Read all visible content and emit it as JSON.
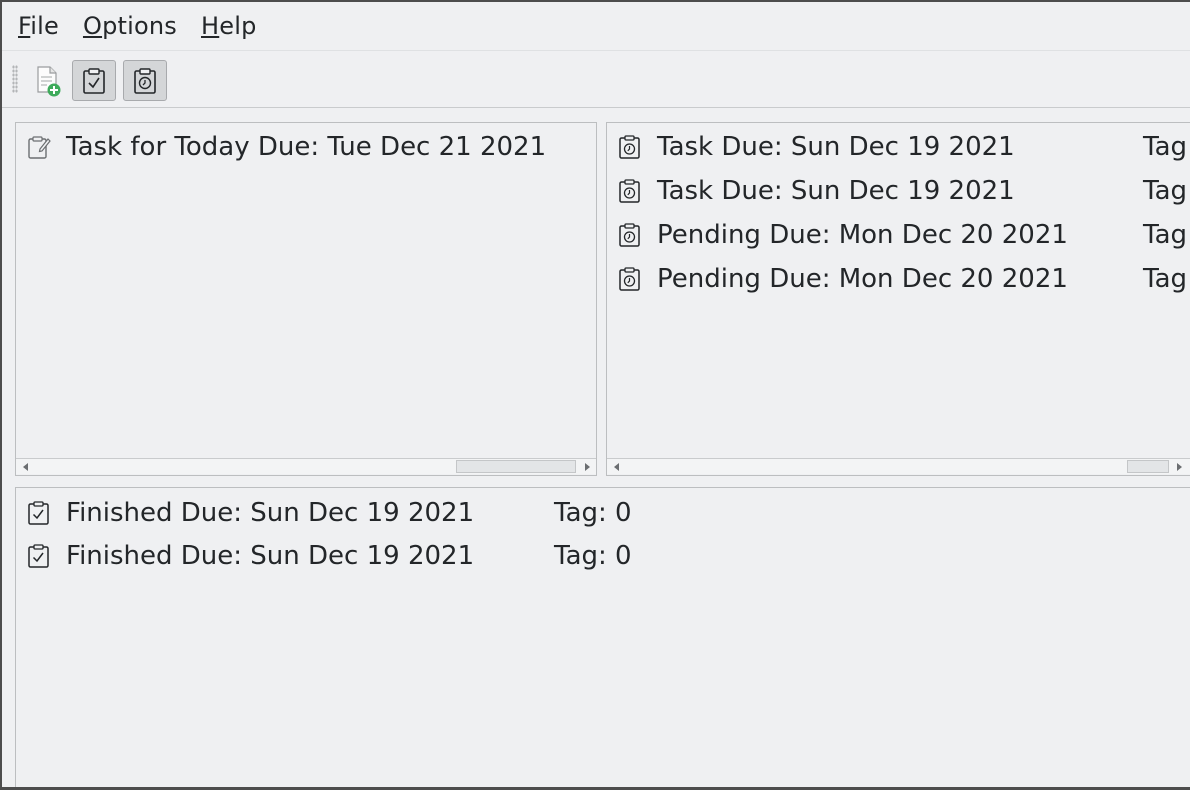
{
  "menubar": {
    "items": [
      {
        "mnemonic": "F",
        "rest": "ile"
      },
      {
        "mnemonic": "O",
        "rest": "ptions"
      },
      {
        "mnemonic": "H",
        "rest": "elp"
      }
    ]
  },
  "toolbar": {
    "buttons": [
      {
        "icon": "new-task-icon",
        "checked": false
      },
      {
        "icon": "clipboard-check-icon",
        "checked": true
      },
      {
        "icon": "clipboard-clock-icon",
        "checked": true
      }
    ]
  },
  "today_list": {
    "items": [
      {
        "icon": "clipboard-edit-icon",
        "text": "Task for Today  Due: Tue Dec 21 2021"
      }
    ]
  },
  "pending_list": {
    "items": [
      {
        "icon": "clipboard-clock-icon",
        "text": "Task  Due: Sun Dec 19 2021",
        "tag": "Tag"
      },
      {
        "icon": "clipboard-clock-icon",
        "text": "Task  Due: Sun Dec 19 2021",
        "tag": "Tag"
      },
      {
        "icon": "clipboard-clock-icon",
        "text": "Pending  Due: Mon Dec 20 2021",
        "tag": "Tag"
      },
      {
        "icon": "clipboard-clock-icon",
        "text": "Pending  Due: Mon Dec 20 2021",
        "tag": "Tag"
      }
    ]
  },
  "finished_list": {
    "items": [
      {
        "icon": "clipboard-check-icon",
        "text": "Finished  Due: Sun Dec 19 2021",
        "tag": "Tag: 0"
      },
      {
        "icon": "clipboard-check-icon",
        "text": "Finished  Due: Sun Dec 19 2021",
        "tag": "Tag: 0"
      }
    ]
  },
  "colors": {
    "window_bg": "#eff0f2",
    "panel_border": "#bcbec0",
    "text": "#232629",
    "add_badge": "#3daa5a"
  }
}
